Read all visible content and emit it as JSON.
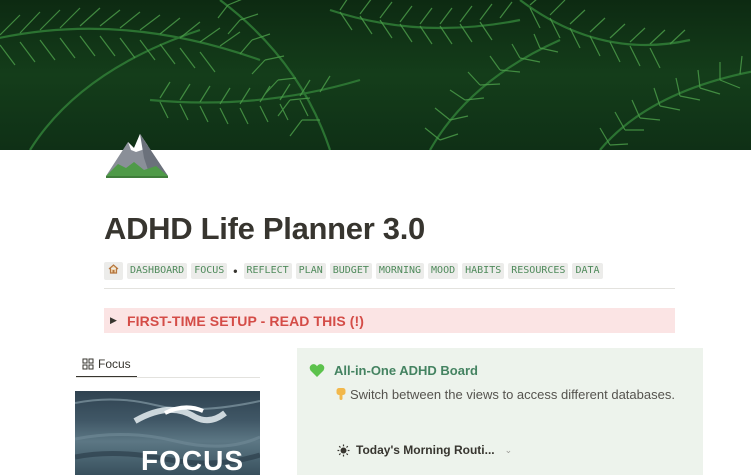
{
  "cover": {
    "icon": "fern-leaves-cover-image"
  },
  "page": {
    "icon": "mountain-icon",
    "title": "ADHD Life Planner 3.0"
  },
  "nav": {
    "home_icon": "house-icon",
    "items_a": [
      "DASHBOARD",
      "FOCUS"
    ],
    "separator": "•",
    "items_b": [
      "REFLECT",
      "PLAN",
      "BUDGET",
      "MORNING",
      "MOOD",
      "HABITS",
      "RESOURCES",
      "DATA"
    ]
  },
  "setup_toggle": {
    "label": "FIRST-TIME SETUP - READ THIS (!)",
    "color": "#d44c47",
    "background": "#fbe4e4"
  },
  "left_view": {
    "tab_icon": "gallery-grid-icon",
    "tab_label": "Focus",
    "card_text": "FOCUS"
  },
  "callout": {
    "icon": "green-heart-icon",
    "title": "All-in-One ADHD Board",
    "pointer_icon": "pointing-down-hand-icon",
    "description": "Switch between the views to access different databases.",
    "view_icon": "sun-icon",
    "view_label": "Today's Morning Routi...",
    "background": "#edf3ec",
    "title_color": "#448361"
  }
}
